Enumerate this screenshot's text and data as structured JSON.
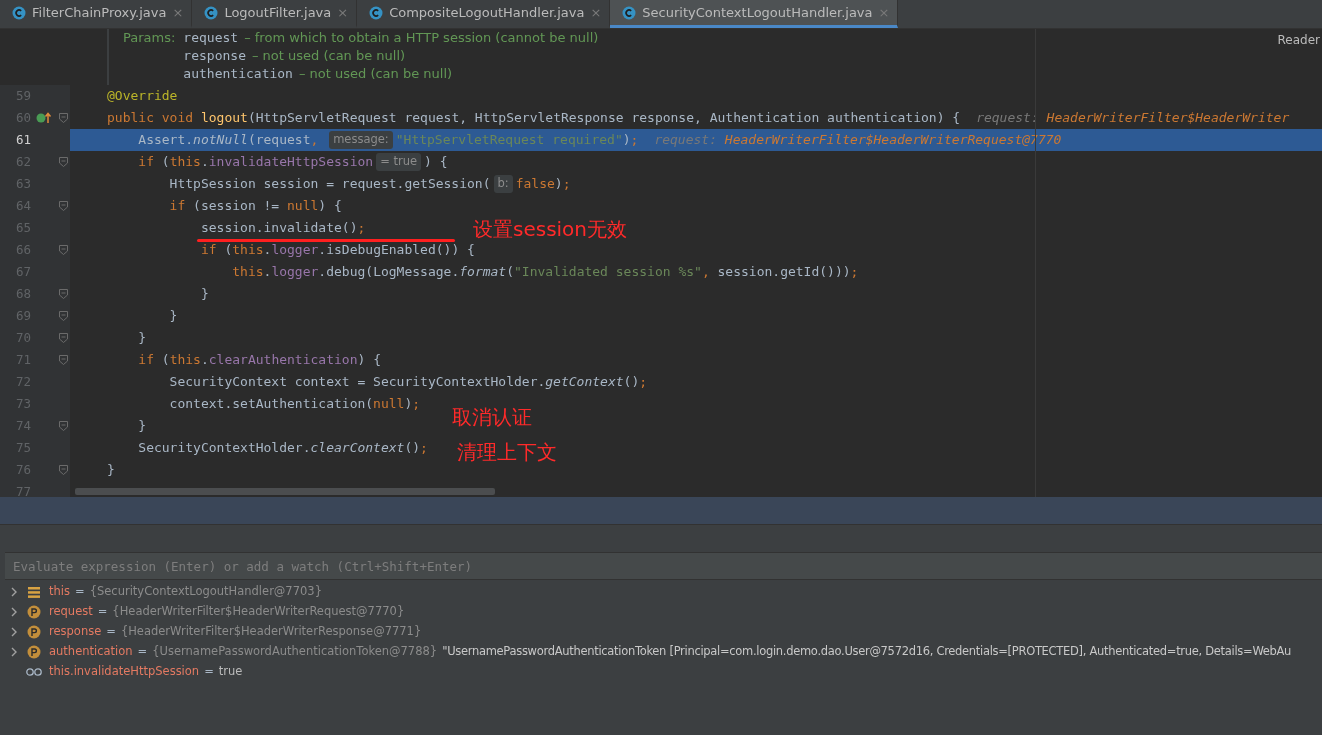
{
  "tabs": [
    {
      "label": "FilterChainProxy.java",
      "close": "×",
      "selected": false
    },
    {
      "label": "LogoutFilter.java",
      "close": "×",
      "selected": false
    },
    {
      "label": "CompositeLogoutHandler.java",
      "close": "×",
      "selected": false
    },
    {
      "label": "SecurityContextLogoutHandler.java",
      "close": "×",
      "selected": true
    }
  ],
  "reader_mode": "Reader",
  "doc": {
    "label": "Params:",
    "params": [
      {
        "name": "request",
        "desc": "– from which to obtain a HTTP session (cannot be null)"
      },
      {
        "name": "response",
        "desc": "– not used (can be null)"
      },
      {
        "name": "authentication",
        "desc": "– not used (can be null)"
      }
    ]
  },
  "lines": [
    {
      "number": "59",
      "fold": false,
      "selected": false,
      "tokens": [
        {
          "kind": "ann",
          "t": "@Override"
        }
      ]
    },
    {
      "number": "60",
      "fold": true,
      "selected": false,
      "gutter_icon": true,
      "tokens": [
        {
          "kind": "kw",
          "t": "public void "
        },
        {
          "kind": "method",
          "t": "logout"
        },
        {
          "kind": "plain",
          "t": "(HttpServletRequest request, HttpServletResponse response, Authentication authentication) {"
        },
        {
          "kind": "hint_label",
          "t": "request: "
        },
        {
          "kind": "hint_value",
          "t": "HeaderWriterFilter$HeaderWriter"
        }
      ]
    },
    {
      "number": "61",
      "fold": false,
      "selected": true,
      "tokens": [
        {
          "kind": "plain",
          "t": "    Assert."
        },
        {
          "kind": "italic",
          "t": "notNull"
        },
        {
          "kind": "plain",
          "t": "(request"
        },
        {
          "kind": "kw",
          "t": ", "
        },
        {
          "kind": "inlay",
          "t": "message:"
        },
        {
          "kind": "string",
          "t": "\"HttpServletRequest required\""
        },
        {
          "kind": "plain",
          "t": ")"
        },
        {
          "kind": "kw",
          "t": ";"
        },
        {
          "kind": "hint_label",
          "t": "request: "
        },
        {
          "kind": "hint_value",
          "t": "HeaderWriterFilter$HeaderWriterRequest@7770"
        }
      ]
    },
    {
      "number": "62",
      "fold": true,
      "selected": false,
      "tokens": [
        {
          "kind": "kw",
          "t": "    if"
        },
        {
          "kind": "plain",
          "t": " ("
        },
        {
          "kind": "kw",
          "t": "this"
        },
        {
          "kind": "plain",
          "t": "."
        },
        {
          "kind": "field",
          "t": "invalidateHttpSession"
        },
        {
          "kind": "inlay",
          "t": "= true"
        },
        {
          "kind": "plain",
          "t": ") {"
        }
      ]
    },
    {
      "number": "63",
      "fold": false,
      "selected": false,
      "tokens": [
        {
          "kind": "plain",
          "t": "        HttpSession session = request.getSession("
        },
        {
          "kind": "inlay",
          "t": "b:"
        },
        {
          "kind": "kw",
          "t": "false"
        },
        {
          "kind": "plain",
          "t": ")"
        },
        {
          "kind": "kw",
          "t": ";"
        }
      ]
    },
    {
      "number": "64",
      "fold": true,
      "selected": false,
      "tokens": [
        {
          "kind": "kw",
          "t": "        if"
        },
        {
          "kind": "plain",
          "t": " (session != "
        },
        {
          "kind": "kw",
          "t": "null"
        },
        {
          "kind": "plain",
          "t": ") {"
        }
      ]
    },
    {
      "number": "65",
      "fold": false,
      "selected": false,
      "tokens": [
        {
          "kind": "plain",
          "t": "            session.invalidate()"
        },
        {
          "kind": "kw",
          "t": ";"
        }
      ]
    },
    {
      "number": "66",
      "fold": true,
      "selected": false,
      "tokens": [
        {
          "kind": "kw",
          "t": "            if"
        },
        {
          "kind": "plain",
          "t": " ("
        },
        {
          "kind": "kw",
          "t": "this"
        },
        {
          "kind": "plain",
          "t": "."
        },
        {
          "kind": "field",
          "t": "logger"
        },
        {
          "kind": "plain",
          "t": ".isDebugEnabled()) {"
        }
      ]
    },
    {
      "number": "67",
      "fold": false,
      "selected": false,
      "tokens": [
        {
          "kind": "kw",
          "t": "                this"
        },
        {
          "kind": "plain",
          "t": "."
        },
        {
          "kind": "field",
          "t": "logger"
        },
        {
          "kind": "plain",
          "t": ".debug(LogMessage."
        },
        {
          "kind": "italic",
          "t": "format"
        },
        {
          "kind": "plain",
          "t": "("
        },
        {
          "kind": "string",
          "t": "\"Invalidated session %s\""
        },
        {
          "kind": "kw",
          "t": ", "
        },
        {
          "kind": "plain",
          "t": "session.getId()))"
        },
        {
          "kind": "kw",
          "t": ";"
        }
      ]
    },
    {
      "number": "68",
      "fold": true,
      "selected": false,
      "tokens": [
        {
          "kind": "plain",
          "t": "            }"
        }
      ]
    },
    {
      "number": "69",
      "fold": true,
      "selected": false,
      "tokens": [
        {
          "kind": "plain",
          "t": "        }"
        }
      ]
    },
    {
      "number": "70",
      "fold": true,
      "selected": false,
      "tokens": [
        {
          "kind": "plain",
          "t": "    }"
        }
      ]
    },
    {
      "number": "71",
      "fold": true,
      "selected": false,
      "tokens": [
        {
          "kind": "kw",
          "t": "    if"
        },
        {
          "kind": "plain",
          "t": " ("
        },
        {
          "kind": "kw",
          "t": "this"
        },
        {
          "kind": "plain",
          "t": "."
        },
        {
          "kind": "field",
          "t": "clearAuthentication"
        },
        {
          "kind": "plain",
          "t": ") {"
        }
      ]
    },
    {
      "number": "72",
      "fold": false,
      "selected": false,
      "tokens": [
        {
          "kind": "plain",
          "t": "        SecurityContext context = SecurityContextHolder."
        },
        {
          "kind": "italic",
          "t": "getContext"
        },
        {
          "kind": "plain",
          "t": "()"
        },
        {
          "kind": "kw",
          "t": ";"
        }
      ]
    },
    {
      "number": "73",
      "fold": false,
      "selected": false,
      "tokens": [
        {
          "kind": "plain",
          "t": "        context.setAuthentication("
        },
        {
          "kind": "kw",
          "t": "null"
        },
        {
          "kind": "plain",
          "t": ")"
        },
        {
          "kind": "kw",
          "t": ";"
        }
      ]
    },
    {
      "number": "74",
      "fold": true,
      "selected": false,
      "tokens": [
        {
          "kind": "plain",
          "t": "    }"
        }
      ]
    },
    {
      "number": "75",
      "fold": false,
      "selected": false,
      "tokens": [
        {
          "kind": "plain",
          "t": "    SecurityContextHolder."
        },
        {
          "kind": "italic",
          "t": "clearContext"
        },
        {
          "kind": "plain",
          "t": "()"
        },
        {
          "kind": "kw",
          "t": ";"
        }
      ]
    },
    {
      "number": "76",
      "fold": true,
      "selected": false,
      "tokens": [
        {
          "kind": "plain",
          "t": "}"
        }
      ]
    },
    {
      "number": "77",
      "fold": false,
      "selected": false
    }
  ],
  "annotations": [
    {
      "kind": "underlined",
      "text": "设置session无效"
    },
    {
      "kind": "plain",
      "text": "取消认证"
    },
    {
      "kind": "plain",
      "text": "清理上下文"
    }
  ],
  "debugger": {
    "placeholder": "Evaluate expression (Enter) or add a watch (Ctrl+Shift+Enter)",
    "variables": [
      {
        "kind": "field",
        "expandable": true,
        "name": "this",
        "eq": "=",
        "value": "{SecurityContextLogoutHandler@7703}"
      },
      {
        "kind": "param",
        "expandable": true,
        "name": "request",
        "eq": "=",
        "value": "{HeaderWriterFilter$HeaderWriterRequest@7770}"
      },
      {
        "kind": "param",
        "expandable": true,
        "name": "response",
        "eq": "=",
        "value": "{HeaderWriterFilter$HeaderWriterResponse@7771}"
      },
      {
        "kind": "param",
        "expandable": true,
        "name": "authentication",
        "eq": "=",
        "value": "{UsernamePasswordAuthenticationToken@7788}",
        "text": "\"UsernamePasswordAuthenticationToken [Principal=com.login.demo.dao.User@7572d16, Credentials=[PROTECTED], Authenticated=true, Details=WebAu"
      },
      {
        "kind": "watch",
        "expandable": false,
        "name": "this.invalidateHttpSession",
        "eq": "=",
        "value": "true"
      }
    ]
  }
}
